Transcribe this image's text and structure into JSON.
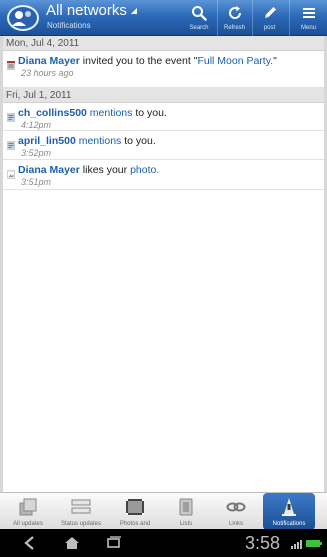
{
  "topbar": {
    "title": "All networks",
    "subtitle": "Notifications",
    "buttons": [
      {
        "label": "Search",
        "icon": "search-icon"
      },
      {
        "label": "Refresh",
        "icon": "refresh-icon"
      },
      {
        "label": "post",
        "icon": "pencil-icon"
      },
      {
        "label": "Menu",
        "icon": "menu-icon"
      }
    ]
  },
  "sections": [
    {
      "date": "Mon, Jul 4, 2011",
      "items": [
        {
          "user": "Diana Mayer",
          "text": " invited you to the event \"",
          "link": "Full Moon Party.",
          "after": "\"",
          "time": "23 hours ago"
        }
      ]
    },
    {
      "date": "Fri, Jul 1, 2011",
      "items": [
        {
          "user": "ch_collins500",
          "text": " ",
          "link": "mentions",
          "after": " to you.",
          "time": "4:12pm"
        },
        {
          "user": "april_lin500",
          "text": " ",
          "link": "mentions",
          "after": " to you.",
          "time": "3:52pm"
        },
        {
          "user": "Diana Mayer",
          "text": " likes your ",
          "link": "photo.",
          "after": "",
          "time": "3:51pm"
        }
      ]
    }
  ],
  "tabs": [
    {
      "label": "All updates",
      "icon": "all-updates-icon"
    },
    {
      "label": "Status updates",
      "icon": "status-updates-icon"
    },
    {
      "label": "Photos and",
      "icon": "photos-icon"
    },
    {
      "label": "Lists",
      "icon": "lists-icon"
    },
    {
      "label": "Links",
      "icon": "links-icon"
    },
    {
      "label": "Notifications",
      "icon": "notifications-icon",
      "active": true
    }
  ],
  "statusbar": {
    "time": "3:58"
  },
  "colors": {
    "accent": "#2d6ab9",
    "link": "#1b5fb3",
    "active_tab": "#1b4f94"
  }
}
